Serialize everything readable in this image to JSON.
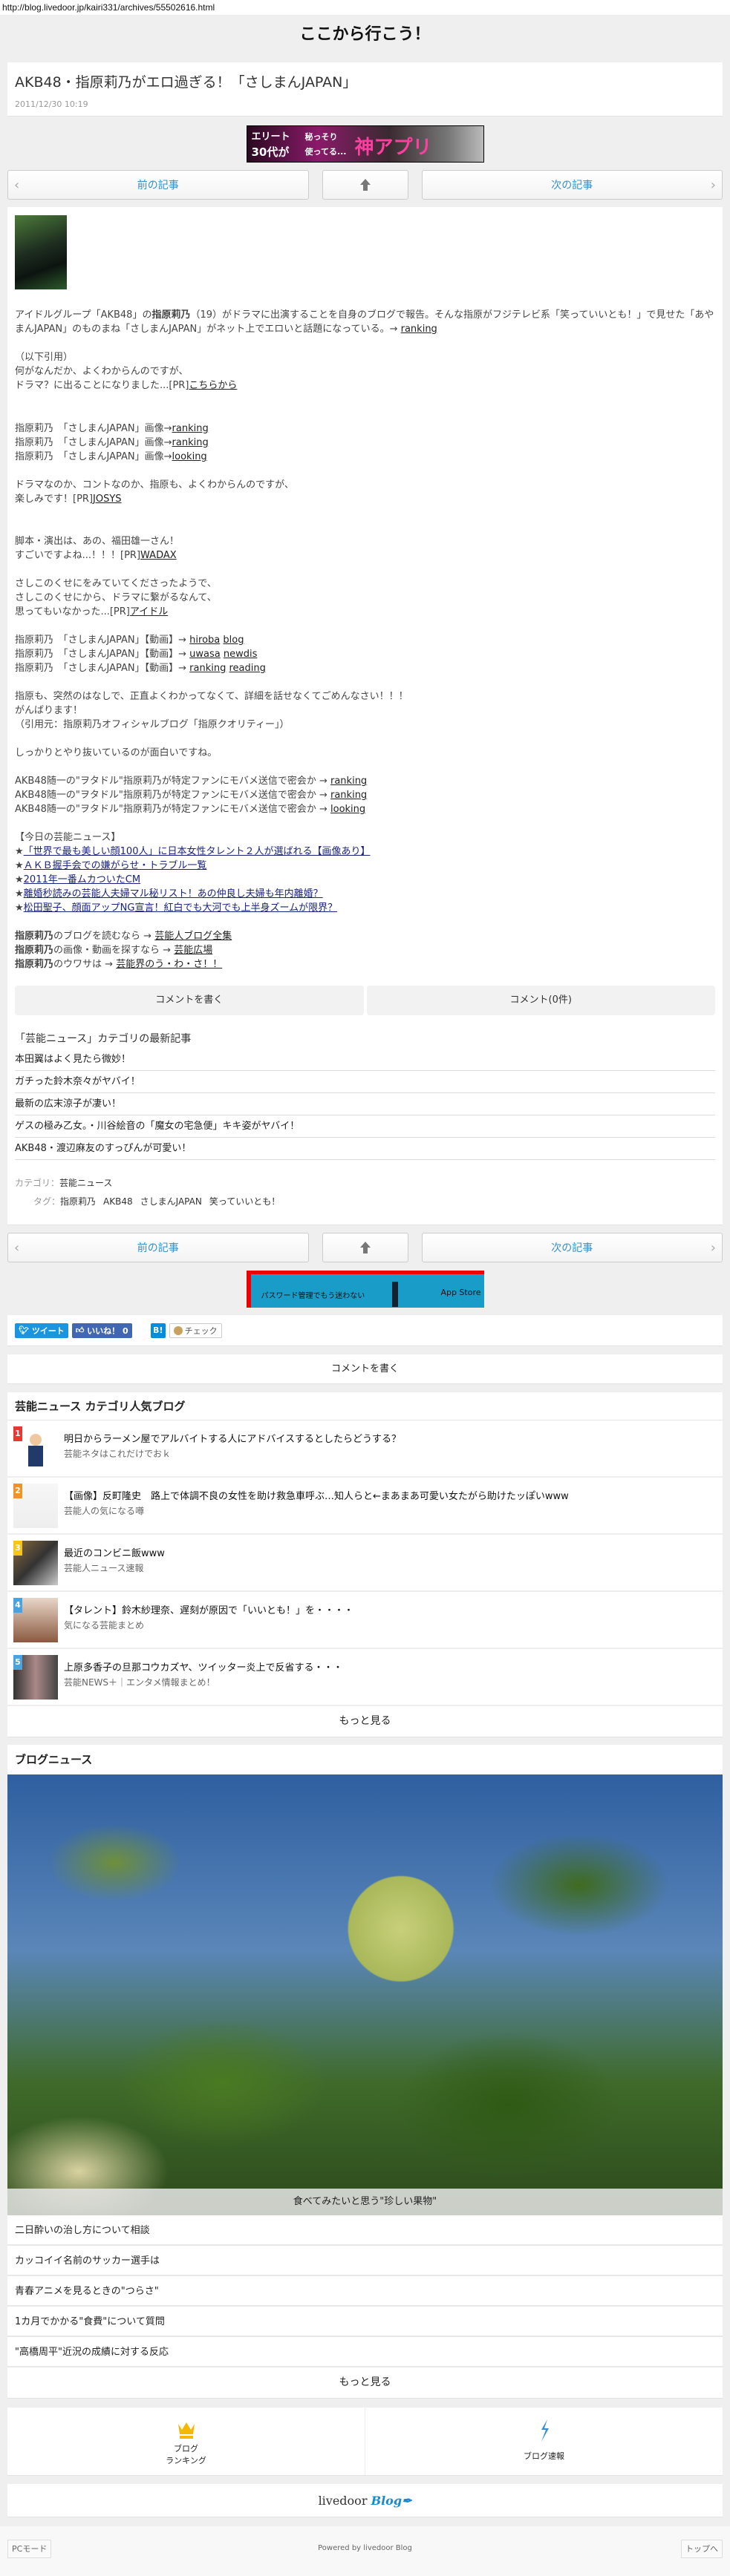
{
  "url": "http://blog.livedoor.jp/kairi331/archives/55502616.html",
  "site_title": "ここから行こう！",
  "article": {
    "title": "AKB48・指原莉乃がエロ過ぎる！「さしまんJAPAN」",
    "date": "2011/12/30 10:19"
  },
  "ad_top": {
    "line1": "エリート",
    "line2": "30代が",
    "line3": "秘っそり",
    "line4": "使ってる...",
    "line5": "神アプリ"
  },
  "nav": {
    "prev": "前の記事",
    "next": "次の記事",
    "home_icon": "home-icon"
  },
  "body": [
    [
      [
        {
          "t": "アイドルグループ「AKB48」の"
        },
        {
          "t": "指原莉乃",
          "b": true
        },
        {
          "t": "（19）がドラマに出演することを自身のブログで報告。そんな指原がフジテレビ系「笑っていいとも！」で見せた「あやまんJAPAN」のものまね「さしまんJAPAN」がネット上でエロいと話題になっている。→ "
        },
        {
          "a": "ranking"
        }
      ]
    ],
    [
      [
        {
          "t": "（以下引用）"
        }
      ],
      [
        {
          "t": "何がなんだか、よくわからんのですが、"
        }
      ],
      [
        {
          "t": "ドラマ？に出ることになりました...[PR]"
        },
        {
          "a": "こちらから"
        }
      ],
      []
    ],
    [
      [
        {
          "t": "指原莉乃　「さしまんJAPAN」画像→"
        },
        {
          "a": "ranking"
        }
      ],
      [
        {
          "t": "指原莉乃　「さしまんJAPAN」画像→"
        },
        {
          "a": "ranking"
        }
      ],
      [
        {
          "t": "指原莉乃　「さしまんJAPAN」画像→"
        },
        {
          "a": "looking"
        }
      ]
    ],
    [
      [
        {
          "t": "ドラマなのか、コントなのか、指原も、よくわからんのですが、"
        }
      ],
      [
        {
          "t": "楽しみです！[PR]"
        },
        {
          "a": "JOSYS"
        }
      ],
      []
    ],
    [
      [
        {
          "t": "脚本・演出は、あの、福田雄一さん！"
        }
      ],
      [
        {
          "t": "すごいですよね...！！！[PR]"
        },
        {
          "a": "WADAX"
        }
      ]
    ],
    [
      [
        {
          "t": "さしこのくせにをみていてくださったようで、"
        }
      ],
      [
        {
          "t": "さしこのくせにから、ドラマに繋がるなんて、"
        }
      ],
      [
        {
          "t": "思ってもいなかった...[PR]"
        },
        {
          "a": "アイドル"
        }
      ]
    ],
    [
      [
        {
          "t": "指原莉乃　「さしまんJAPAN」【動画】→ "
        },
        {
          "a": "hiroba"
        },
        {
          "t": " "
        },
        {
          "a": "blog"
        }
      ],
      [
        {
          "t": "指原莉乃　「さしまんJAPAN」【動画】→ "
        },
        {
          "a": "uwasa"
        },
        {
          "t": " "
        },
        {
          "a": "newdis"
        }
      ],
      [
        {
          "t": "指原莉乃　「さしまんJAPAN」【動画】→ "
        },
        {
          "a": "ranking"
        },
        {
          "t": " "
        },
        {
          "a": "reading"
        }
      ]
    ],
    [
      [
        {
          "t": "指原も、突然のはなしで、正直よくわかってなくて、詳細を話せなくてごめんなさい！！！"
        }
      ],
      [
        {
          "t": "がんばります！"
        }
      ],
      [
        {
          "t": "（引用元：指原莉乃オフィシャルブログ「指原クオリティー」）"
        }
      ]
    ],
    [
      [
        {
          "t": "しっかりとやり抜いているのが面白いですね。"
        }
      ]
    ],
    [
      [
        {
          "t": "AKB48随一の\"ヲタドル\"指原莉乃が特定ファンにモバメ送信で密会か → "
        },
        {
          "a": "ranking"
        }
      ],
      [
        {
          "t": "AKB48随一の\"ヲタドル\"指原莉乃が特定ファンにモバメ送信で密会か → "
        },
        {
          "a": "ranking"
        }
      ],
      [
        {
          "t": "AKB48随一の\"ヲタドル\"指原莉乃が特定ファンにモバメ送信で密会か → "
        },
        {
          "a": "looking"
        }
      ]
    ],
    [
      [
        {
          "t": "【今日の芸能ニュース】"
        }
      ],
      [
        {
          "t": "★"
        },
        {
          "a": "「世界で最も美しい顔100人」に日本女性タレント２人が選ばれる【画像あり】",
          "s": true
        }
      ],
      [
        {
          "t": "★"
        },
        {
          "a": "ＡＫＢ握手会での嫌がらせ・トラブル一覧",
          "s": true
        }
      ],
      [
        {
          "t": "★"
        },
        {
          "a": "2011年一番ムカついたCM",
          "s": true
        }
      ],
      [
        {
          "t": "★"
        },
        {
          "a": "離婚秒読みの芸能人夫婦マル秘リスト！あの仲良し夫婦も年内離婚？",
          "s": true
        }
      ],
      [
        {
          "t": "★"
        },
        {
          "a": "松田聖子、顔面アップNG宣言！紅白でも大河でも上半身ズームが限界？",
          "s": true
        }
      ]
    ],
    [
      [
        {
          "t": "指原莉乃",
          "b": true
        },
        {
          "t": "のブログを読むなら → "
        },
        {
          "a": "芸能人ブログ全集"
        }
      ],
      [
        {
          "t": "指原莉乃",
          "b": true
        },
        {
          "t": "の画像・動画を探すなら → "
        },
        {
          "a": "芸能広場"
        }
      ],
      [
        {
          "t": "指原莉乃",
          "b": true
        },
        {
          "t": "のウワサは → "
        },
        {
          "a": "芸能界のう・わ・さ！！"
        }
      ]
    ]
  ],
  "comment_buttons": {
    "write": "コメントを書く",
    "count": "コメント(0件)"
  },
  "latest": {
    "heading": "「芸能ニュース」カテゴリの最新記事",
    "items": [
      "本田翼はよく見たら微妙！",
      "ガチった鈴木奈々がヤバイ！",
      "最新の広末涼子が凄い！",
      "ゲスの極み乙女。・川谷絵音の「魔女の宅急便」キキ姿がヤバイ！",
      "AKB48・渡辺麻友のすっぴんが可愛い！"
    ]
  },
  "meta": {
    "category_label": "カテゴリ：",
    "category": "芸能ニュース",
    "tag_label": "タグ：",
    "tags": [
      "指原莉乃",
      "AKB48",
      "さしまんJAPAN",
      "笑っていいとも！"
    ]
  },
  "ad_bottom": {
    "text": "パスワード管理でもう迷わない",
    "store": "App Store"
  },
  "social": {
    "tweet": "ツイート",
    "like": "いいね！ 0",
    "hatena": "B!",
    "check": "チェック"
  },
  "comment_write": "コメントを書く",
  "popular": {
    "heading": "芸能ニュース カテゴリ人気ブログ",
    "items": [
      {
        "rank": "1",
        "title": "明日からラーメン屋でアルバイトする人にアドバイスするとしたらどうする？",
        "blog": "芸能ネタはこれだけでおｋ",
        "color": "#e53935"
      },
      {
        "rank": "2",
        "title": "【画像】反町隆史　路上で体調不良の女性を助け救急車呼ぶ…知人らと←まあまあ可愛い女たがら助けたッぽいwww",
        "blog": "芸能人の気になる噂",
        "color": "#f0932b"
      },
      {
        "rank": "3",
        "title": "最近のコンビニ飯www",
        "blog": "芸能人ニュース速報",
        "color": "#f5c518"
      },
      {
        "rank": "4",
        "title": "【タレント】鈴木紗理奈、遅刻が原因で「いいとも！」を・・・・",
        "blog": "気になる芸能まとめ",
        "color": "#4aa3df"
      },
      {
        "rank": "5",
        "title": "上原多香子の旦那コウカズヤ、ツイッター炎上で反省する・・・",
        "blog": "芸能NEWS＋｜エンタメ情報まとめ！",
        "color": "#4aa3df"
      }
    ],
    "more": "もっと見る"
  },
  "blog_news": {
    "heading": "ブログニュース",
    "caption": "食べてみたいと思う\"珍しい果物\"",
    "items": [
      "二日酔いの治し方について相談",
      "カッコイイ名前のサッカー選手は",
      "青春アニメを見るときの\"つらさ\"",
      "1カ月でかかる\"食費\"について質問",
      "\"高橋周平\"近況の成績に対する反応"
    ],
    "more": "もっと見る"
  },
  "footer_nav": {
    "ranking_l1": "ブログ",
    "ranking_l2": "ランキング",
    "flash": "ブログ速報"
  },
  "logo": {
    "a": "livedoor",
    "b": "Blog"
  },
  "footer": {
    "pc": "PCモード",
    "powered": "Powered by livedoor Blog",
    "top": "トップへ"
  }
}
